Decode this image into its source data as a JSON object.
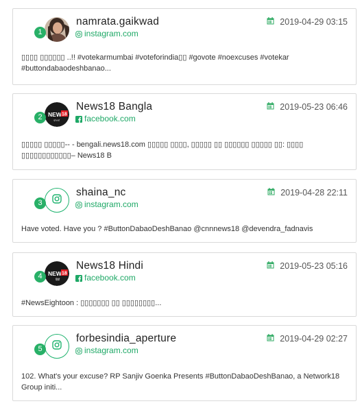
{
  "colors": {
    "accent": "#1ea866",
    "badge": "#28b067",
    "border": "#d9d9d9"
  },
  "posts": [
    {
      "rank": "1",
      "name": "namrata.gaikwad",
      "source": "instagram.com",
      "source_icon": "instagram-icon",
      "date": "2019-04-29 03:15",
      "avatar": "profile-photo",
      "text": "▯▯▯▯ ▯▯▯▯▯▯ ..!! #votekarmumbai #voteforindia▯▯ #govote #noexcuses #votekar #buttondabaodeshbanao..."
    },
    {
      "rank": "2",
      "name": "News18 Bangla",
      "source": "facebook.com",
      "source_icon": "facebook-icon",
      "date": "2019-05-23 06:46",
      "avatar": "news18-bangla-logo",
      "text": "▯▯▯▯▯ ▯▯▯▯▯-- - bengali.news18.com ▯▯▯▯▯ ▯▯▯▯, ▯▯▯▯▯ ▯▯ ▯▯▯▯▯▯ ▯▯▯▯▯ ▯▯: ▯▯▯▯ ▯▯▯▯▯▯▯▯▯▯▯▯– News18 B"
    },
    {
      "rank": "3",
      "name": "shaina_nc",
      "source": "instagram.com",
      "source_icon": "instagram-icon",
      "date": "2019-04-28 22:11",
      "avatar": "instagram-placeholder",
      "text": "Have voted. Have you ? #ButtonDabaoDeshBanao @cnnnews18 @devendra_fadnavis"
    },
    {
      "rank": "4",
      "name": "News18 Hindi",
      "source": "facebook.com",
      "source_icon": "facebook-icon",
      "date": "2019-05-23 05:16",
      "avatar": "news18-hindi-logo",
      "text": "#NewsEightoon : ▯▯▯▯▯▯▯ ▯▯ ▯▯▯▯▯▯▯▯..."
    },
    {
      "rank": "5",
      "name": "forbesindia_aperture",
      "source": "instagram.com",
      "source_icon": "instagram-icon",
      "date": "2019-04-29 02:27",
      "avatar": "instagram-placeholder",
      "text": "102. What's your excuse? RP Sanjiv Goenka Presents #ButtonDabaoDeshBanao, a Network18 Group initi..."
    }
  ]
}
